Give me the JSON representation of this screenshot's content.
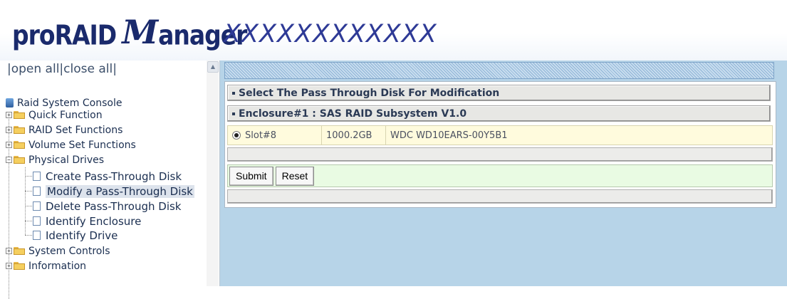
{
  "header": {
    "logo_pro": "proRAID",
    "logo_m": "M",
    "logo_anager": "anager",
    "model": "XXXXXXXXXXXX"
  },
  "left": {
    "open_all": "|open all",
    "close_all": "|close all|",
    "tree": [
      {
        "label": "Raid System Console",
        "type": "root",
        "icon": "console-icon"
      },
      {
        "label": "Quick Function",
        "type": "folder",
        "state": "collapsed"
      },
      {
        "label": "RAID Set Functions",
        "type": "folder",
        "state": "collapsed"
      },
      {
        "label": "Volume Set Functions",
        "type": "folder",
        "state": "collapsed"
      },
      {
        "label": "Physical Drives",
        "type": "folder",
        "state": "expanded"
      },
      {
        "label": "Create Pass-Through Disk",
        "type": "leaf"
      },
      {
        "label": "Modify a Pass-Through Disk",
        "type": "leaf",
        "selected": true
      },
      {
        "label": "Delete Pass-Through Disk",
        "type": "leaf"
      },
      {
        "label": "Identify Enclosure",
        "type": "leaf"
      },
      {
        "label": "Identify Drive",
        "type": "leaf"
      },
      {
        "label": "System Controls",
        "type": "folder",
        "state": "collapsed"
      },
      {
        "label": "Information",
        "type": "folder",
        "state": "collapsed"
      }
    ]
  },
  "main": {
    "section_title": "Select The Pass Through Disk For Modification",
    "enclosure_title": "Enclosure#1 : SAS RAID Subsystem V1.0",
    "disk_row": {
      "selected": true,
      "slot": "Slot#8",
      "capacity": "1000.2GB",
      "model": "WDC WD10EARS-00Y5B1"
    },
    "buttons": {
      "submit": "Submit",
      "reset": "Reset"
    }
  },
  "colors": {
    "brand_navy": "#1a2a6c",
    "model_blue": "#2e3a96",
    "content_bg": "#b7d4e8",
    "row_highlight": "#fffbdd",
    "button_row": "#e9fbe3"
  }
}
